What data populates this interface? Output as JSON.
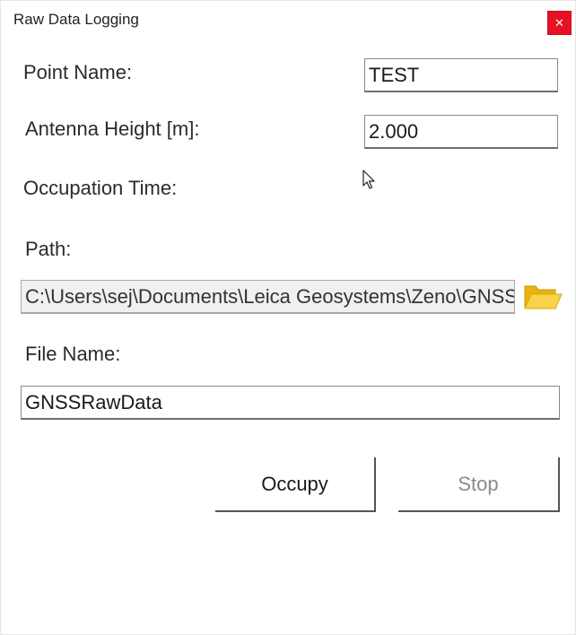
{
  "window": {
    "title": "Raw Data Logging",
    "close_glyph": "✕"
  },
  "form": {
    "point_name": {
      "label": "Point Name:",
      "value": "TEST"
    },
    "antenna_height": {
      "label": "Antenna Height [m]:",
      "value": "2.000"
    },
    "occupation_time": {
      "label": "Occupation Time:"
    },
    "path": {
      "label": "Path:",
      "value": "C:\\Users\\sej\\Documents\\Leica Geosystems\\Zeno\\GNSS"
    },
    "file_name": {
      "label": "File Name:",
      "value": "GNSSRawData"
    }
  },
  "buttons": {
    "occupy_label": "Occupy",
    "stop_label": "Stop"
  },
  "icons": {
    "close": "close-icon",
    "browse": "folder-open-icon",
    "cursor": "mouse-pointer-icon"
  },
  "colors": {
    "close_button": "#e81123",
    "folder": "#f5c518",
    "disabled_text": "#8a8a8a"
  }
}
